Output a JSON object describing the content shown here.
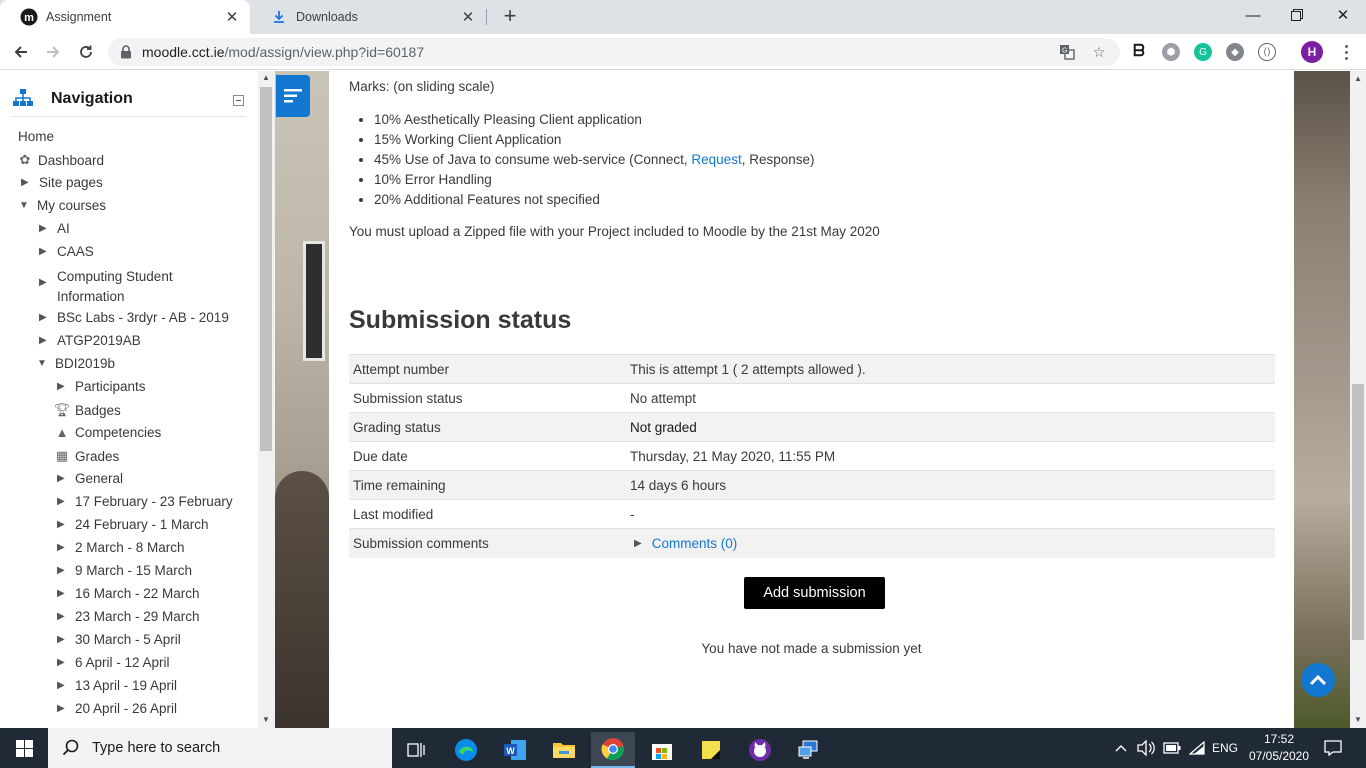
{
  "browser": {
    "tabs": [
      {
        "title": "Assignment",
        "active": true
      },
      {
        "title": "Downloads",
        "active": false
      }
    ],
    "url_host": "moodle.cct.ie",
    "url_path": "/mod/assign/view.php?id=60187",
    "profile_initial": "H"
  },
  "navigation": {
    "title": "Navigation",
    "items": [
      {
        "label": "Home"
      },
      {
        "label": "Dashboard"
      },
      {
        "label": "Site pages"
      },
      {
        "label": "My courses"
      },
      {
        "label": "AI"
      },
      {
        "label": "CAAS"
      },
      {
        "label": "Computing Student"
      },
      {
        "label": "Information"
      },
      {
        "label": "BSc Labs - 3rdyr - AB - 2019"
      },
      {
        "label": "ATGP2019AB"
      },
      {
        "label": "BDI2019b"
      },
      {
        "label": "Participants"
      },
      {
        "label": "Badges"
      },
      {
        "label": "Competencies"
      },
      {
        "label": "Grades"
      },
      {
        "label": "General"
      },
      {
        "label": "17 February - 23 February"
      },
      {
        "label": "24 February - 1 March"
      },
      {
        "label": "2 March - 8 March"
      },
      {
        "label": "9 March - 15 March"
      },
      {
        "label": "16 March - 22 March"
      },
      {
        "label": "23 March - 29 March"
      },
      {
        "label": "30 March - 5 April"
      },
      {
        "label": "6 April - 12 April"
      },
      {
        "label": "13 April - 19 April"
      },
      {
        "label": "20 April - 26 April"
      }
    ]
  },
  "content": {
    "marks_line": "Marks: (on sliding scale)",
    "criteria": [
      {
        "text": "10% Aesthetically Pleasing Client application"
      },
      {
        "text": "15% Working Client Application"
      },
      {
        "pre": "45% Use of Java to consume web-service (Connect, ",
        "link": "Request",
        "post": ", Response)"
      },
      {
        "text": "10% Error Handling"
      },
      {
        "text": "20% Additional Features not specified"
      }
    ],
    "upload_note": "You must upload a Zipped file with your Project included to Moodle by the 21st May 2020",
    "section_title": "Submission status",
    "status_rows": [
      {
        "key": "Attempt number",
        "value": "This is attempt 1 ( 2 attempts allowed )."
      },
      {
        "key": "Submission status",
        "value": "No attempt"
      },
      {
        "key": "Grading status",
        "value": "Not graded"
      },
      {
        "key": "Due date",
        "value": "Thursday, 21 May 2020, 11:55 PM"
      },
      {
        "key": "Time remaining",
        "value": "14 days 6 hours"
      },
      {
        "key": "Last modified",
        "value": "-"
      },
      {
        "key": "Submission comments",
        "value": "Comments (0)"
      }
    ],
    "add_submission_label": "Add submission",
    "no_submission_text": "You have not made a submission yet"
  },
  "taskbar": {
    "search_placeholder": "Type here to search",
    "language": "ENG",
    "time": "17:52",
    "date": "07/05/2020"
  },
  "colors": {
    "accent": "#1177d1",
    "chrome_tabstrip": "#dee1e6",
    "taskbar": "#202a36"
  }
}
